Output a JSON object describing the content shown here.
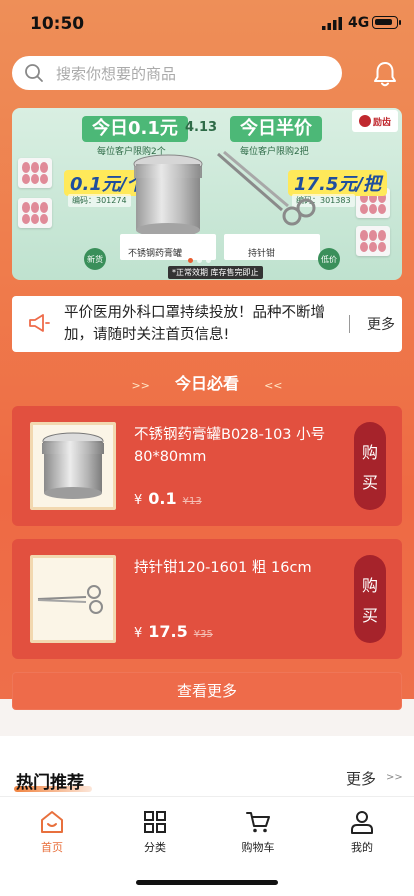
{
  "status_bar": {
    "time": "10:50",
    "network": "4G"
  },
  "search": {
    "placeholder": "搜索你想要的商品"
  },
  "banner": {
    "left": {
      "title": "今日0.1元",
      "subtitle": "每位客户限购2个",
      "price": "0.1元/个",
      "price_label": "新价格",
      "code": "编码：301274",
      "name": "不锈钢药膏罐",
      "spec": "B028-103 小号 80*80mm",
      "badge": "新货"
    },
    "date": "4.13",
    "right": {
      "title": "今日半价",
      "subtitle": "每位客户限购2把",
      "price": "17.5元/把",
      "price_label": "新价格",
      "code": "编码：301383",
      "name": "持针钳",
      "spec": "120-1601 粗 16cm",
      "badge": "低价"
    },
    "note": "*正常效期 库存售完即止",
    "brand": "励齿"
  },
  "notice": {
    "text": "平价医用外科口罩持续投放！品种不断增加，请随时关注首页信息!",
    "more": "更多"
  },
  "section": {
    "left_arrows": ">>",
    "title": "今日必看",
    "right_arrows": "<<"
  },
  "products": [
    {
      "name": "不锈钢药膏罐B028-103 小号80*80mm",
      "currency": "¥",
      "price": "0.1",
      "old_price": "¥13",
      "buy": [
        "购",
        "买"
      ]
    },
    {
      "name": "持针钳120-1601 粗 16cm",
      "currency": "¥",
      "price": "17.5",
      "old_price": "¥35",
      "buy": [
        "购",
        "买"
      ]
    }
  ],
  "view_more": "查看更多",
  "hot": {
    "title": "热门推荐",
    "more": "更多",
    "arrows": ">>"
  },
  "tabbar": [
    {
      "label": "首页",
      "icon": "home-icon",
      "active": true
    },
    {
      "label": "分类",
      "icon": "grid-icon",
      "active": false
    },
    {
      "label": "购物车",
      "icon": "cart-icon",
      "active": false
    },
    {
      "label": "我的",
      "icon": "user-icon",
      "active": false
    }
  ],
  "colors": {
    "accent": "#e8703d",
    "card": "#e2503f",
    "buy_button": "#a6232b",
    "banner_green": "#4cb877"
  }
}
